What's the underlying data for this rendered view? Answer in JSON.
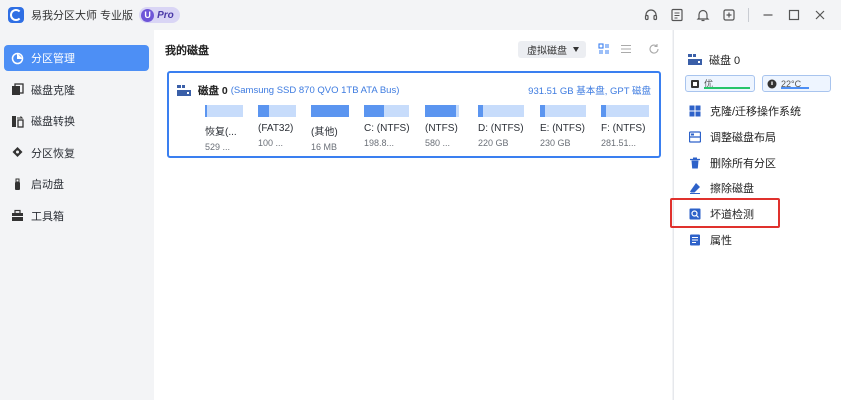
{
  "app": {
    "title": "易我分区大师 专业版",
    "badge_u": "U",
    "badge_text": "Pro"
  },
  "titlebar_icons": [
    "headset-icon",
    "feedback-icon",
    "bell-icon",
    "upgrade-icon",
    "minimize-icon",
    "maximize-icon",
    "close-icon"
  ],
  "sidebar": {
    "items": [
      {
        "label": "分区管理",
        "icon": "pie-icon",
        "active": true
      },
      {
        "label": "磁盘克隆",
        "icon": "clone-icon",
        "active": false
      },
      {
        "label": "磁盘转换",
        "icon": "convert-icon",
        "active": false
      },
      {
        "label": "分区恢复",
        "icon": "recover-icon",
        "active": false
      },
      {
        "label": "启动盘",
        "icon": "usb-icon",
        "active": false
      },
      {
        "label": "工具箱",
        "icon": "toolbox-icon",
        "active": false
      }
    ]
  },
  "main": {
    "title": "我的磁盘",
    "view_select": "虚拟磁盘",
    "disk": {
      "name": "磁盘 0",
      "model": "(Samsung SSD 870 QVO 1TB ATA Bus)",
      "info": "931.51 GB 基本盘, GPT 磁盘",
      "partitions": [
        {
          "label": "恢复(...",
          "size": "529 ...",
          "fill": 0.03
        },
        {
          "label": "(FAT32)",
          "size": "100 ...",
          "fill": 0.3
        },
        {
          "label": "(其他)",
          "size": "16 MB",
          "fill": 1.0
        },
        {
          "label": "C: (NTFS)",
          "size": "198.8...",
          "fill": 0.45
        },
        {
          "label": "(NTFS)",
          "size": "580 ...",
          "fill": 0.9
        },
        {
          "label": "D: (NTFS)",
          "size": "220 GB",
          "fill": 0.1
        },
        {
          "label": "E: (NTFS)",
          "size": "230 GB",
          "fill": 0.1
        },
        {
          "label": "F: (NTFS)",
          "size": "281.51...",
          "fill": 0.1
        }
      ]
    }
  },
  "right_panel": {
    "disk_name": "磁盘 0",
    "health_label": "优",
    "temperature": "22°C",
    "operations": [
      {
        "label": "克隆/迁移操作系统",
        "icon": "migrate-icon"
      },
      {
        "label": "调整磁盘布局",
        "icon": "layout-icon"
      },
      {
        "label": "删除所有分区",
        "icon": "trash-icon"
      },
      {
        "label": "擦除磁盘",
        "icon": "eraser-icon"
      },
      {
        "label": "坏道检测",
        "icon": "scan-icon"
      },
      {
        "label": "属性",
        "icon": "properties-icon"
      }
    ]
  },
  "colors": {
    "accent": "#4d8ff5",
    "partition_fill": "#5b95f0",
    "partition_empty": "#c7dcfb",
    "highlight": "#e0312d"
  }
}
